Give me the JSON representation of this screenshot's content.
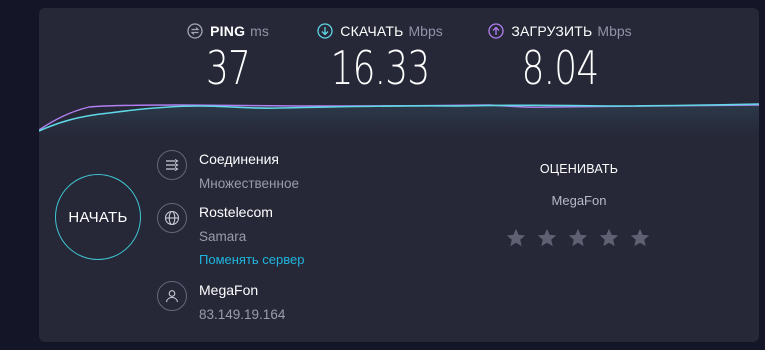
{
  "metrics": {
    "ping": {
      "label": "PING",
      "unit": "ms",
      "value": "37"
    },
    "download": {
      "label": "СКАЧАТЬ",
      "unit": "Mbps",
      "value": "16.33"
    },
    "upload": {
      "label": "ЗАГРУЗИТЬ",
      "unit": "Mbps",
      "value": "8.04"
    }
  },
  "colors": {
    "ping": "#a5a7b8",
    "download": "#5fd7e5",
    "upload": "#b27ff0",
    "accent_ring": "#3fc6d3",
    "link": "#1fb5de"
  },
  "start_button": {
    "label": "НАЧАТЬ"
  },
  "connections": {
    "title": "Соединения",
    "value": "Множественное"
  },
  "server": {
    "name": "Rostelecom",
    "location": "Samara",
    "change_link": "Поменять сервер"
  },
  "isp": {
    "name": "MegaFon",
    "ip": "83.149.19.164"
  },
  "rating": {
    "title": "ОЦЕНИВАТЬ",
    "isp": "MegaFon",
    "stars_total": 5,
    "stars_selected": 0
  }
}
